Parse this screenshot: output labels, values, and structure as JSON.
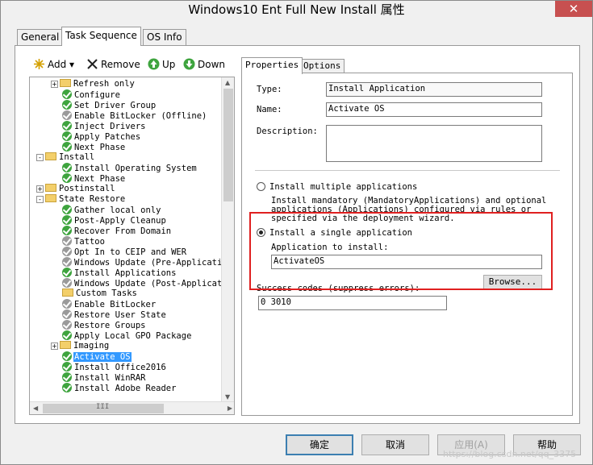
{
  "window": {
    "title": "Windows10 Ent Full New Install 属性",
    "close_symbol": "✕"
  },
  "tabs": [
    "General",
    "Task Sequence",
    "OS Info"
  ],
  "toolbar": {
    "add": "Add",
    "remove": "Remove",
    "up": "Up",
    "down": "Down"
  },
  "tree": {
    "items": [
      {
        "label": "Refresh only",
        "icon": "folder",
        "exp": "+"
      },
      {
        "label": "Configure",
        "icon": "check-green"
      },
      {
        "label": "Set Driver Group",
        "icon": "check-green"
      },
      {
        "label": "Enable BitLocker (Offline)",
        "icon": "check-gray"
      },
      {
        "label": "Inject Drivers",
        "icon": "check-green"
      },
      {
        "label": "Apply Patches",
        "icon": "check-green"
      },
      {
        "label": "Next Phase",
        "icon": "check-green"
      },
      {
        "label": "Install",
        "icon": "folder",
        "exp": "-"
      },
      {
        "label": "Install Operating System",
        "icon": "check-green"
      },
      {
        "label": "Next Phase",
        "icon": "check-green"
      },
      {
        "label": "Postinstall",
        "icon": "folder",
        "exp": "+"
      },
      {
        "label": "State Restore",
        "icon": "folder",
        "exp": "-"
      },
      {
        "label": "Gather local only",
        "icon": "check-green"
      },
      {
        "label": "Post-Apply Cleanup",
        "icon": "check-green"
      },
      {
        "label": "Recover From Domain",
        "icon": "check-green"
      },
      {
        "label": "Tattoo",
        "icon": "check-gray"
      },
      {
        "label": "Opt In to CEIP and WER",
        "icon": "check-gray"
      },
      {
        "label": "Windows Update (Pre-Applicatio",
        "icon": "check-gray"
      },
      {
        "label": "Install Applications",
        "icon": "check-green"
      },
      {
        "label": "Windows Update (Post-Applicati",
        "icon": "check-gray"
      },
      {
        "label": "Custom Tasks",
        "icon": "folder"
      },
      {
        "label": "Enable BitLocker",
        "icon": "check-gray"
      },
      {
        "label": "Restore User State",
        "icon": "check-gray"
      },
      {
        "label": "Restore Groups",
        "icon": "check-gray"
      },
      {
        "label": "Apply Local GPO Package",
        "icon": "check-green"
      },
      {
        "label": "Imaging",
        "icon": "folder",
        "exp": "+"
      },
      {
        "label": "Activate OS",
        "icon": "check-green",
        "selected": true
      },
      {
        "label": "Install Office2016",
        "icon": "check-green"
      },
      {
        "label": "Install WinRAR",
        "icon": "check-green"
      },
      {
        "label": "Install Adobe Reader",
        "icon": "check-green"
      }
    ],
    "hscroll_grip": "III"
  },
  "right_tabs": [
    "Properties",
    "Options"
  ],
  "props": {
    "type_label": "Type:",
    "type_value": "Install Application",
    "name_label": "Name:",
    "name_value": "Activate OS",
    "desc_label": "Description:",
    "desc_value": "",
    "radio_multiple": "Install multiple applications",
    "multiple_desc_1": "Install mandatory (MandatoryApplications) and optional",
    "multiple_desc_2": "applications (Applications) configured via rules or",
    "multiple_desc_3": "specified via the deployment wizard.",
    "radio_single": "Install a single application",
    "app_label": "Application to install:",
    "app_value": "ActivateOS",
    "browse": "Browse...",
    "success_label": "Success codes (suppress errors):",
    "success_value": "0 3010"
  },
  "buttons": {
    "ok": "确定",
    "cancel": "取消",
    "apply": "应用(A)",
    "help": "帮助"
  },
  "watermark": "https://blog.csdn.net/qq_3375",
  "colors": {
    "highlight": "#e02020",
    "selection": "#3399ff"
  }
}
